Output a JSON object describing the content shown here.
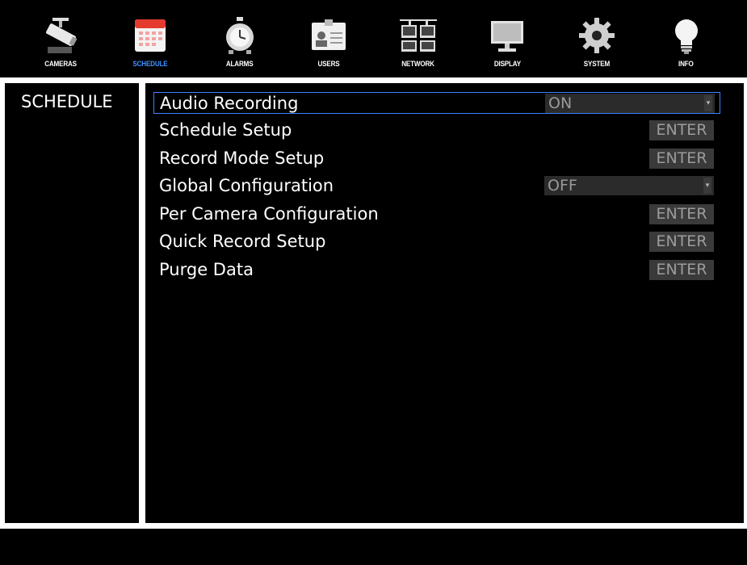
{
  "nav": {
    "tabs": [
      {
        "label": "CAMERAS",
        "icon": "camera-icon",
        "active": false
      },
      {
        "label": "SCHEDULE",
        "icon": "calendar-icon",
        "active": true
      },
      {
        "label": "ALARMS",
        "icon": "alarm-clock-icon",
        "active": false
      },
      {
        "label": "USERS",
        "icon": "id-card-icon",
        "active": false
      },
      {
        "label": "NETWORK",
        "icon": "network-icon",
        "active": false
      },
      {
        "label": "DISPLAY",
        "icon": "monitor-icon",
        "active": false
      },
      {
        "label": "SYSTEM",
        "icon": "gear-icon",
        "active": false
      },
      {
        "label": "INFO",
        "icon": "lightbulb-icon",
        "active": false
      }
    ]
  },
  "section_title": "SCHEDULE",
  "rows": [
    {
      "label": "Audio Recording",
      "control": "select",
      "value": "ON",
      "selected": true
    },
    {
      "label": "Schedule Setup",
      "control": "button",
      "value": "ENTER",
      "selected": false
    },
    {
      "label": "Record Mode Setup",
      "control": "button",
      "value": "ENTER",
      "selected": false
    },
    {
      "label": "Global Configuration",
      "control": "select",
      "value": "OFF",
      "selected": false
    },
    {
      "label": "Per Camera Configuration",
      "control": "button",
      "value": "ENTER",
      "selected": false
    },
    {
      "label": "Quick Record Setup",
      "control": "button",
      "value": "ENTER",
      "selected": false
    },
    {
      "label": "Purge Data",
      "control": "button",
      "value": "ENTER",
      "selected": false
    }
  ],
  "colors": {
    "accent": "#3e83ff",
    "active_tab_label": "#3e90ff",
    "panel_border": "#ffffff"
  }
}
